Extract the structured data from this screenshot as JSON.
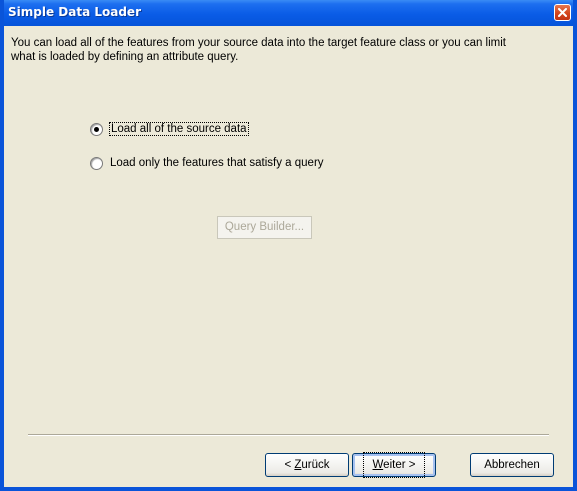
{
  "window": {
    "title": "Simple Data Loader"
  },
  "description": "You can load all of the features from your source data into the target feature class or you can limit what is loaded by defining an attribute query.",
  "options": {
    "load_all": {
      "label": "Load all of the source data",
      "checked": true
    },
    "load_query": {
      "label": "Load only the features that satisfy a query",
      "checked": false
    }
  },
  "query_builder": {
    "label": "Query Builder...",
    "enabled": false
  },
  "footer": {
    "back_prefix": "< ",
    "back_accel": "Z",
    "back_rest": "urück",
    "next_accel": "W",
    "next_rest": "eiter >",
    "cancel_label": "Abbrechen"
  },
  "icons": {
    "close": "close-icon"
  },
  "colors": {
    "titlebar": "#0a5ce6",
    "client": "#ece9d8",
    "close": "#d4451c"
  }
}
